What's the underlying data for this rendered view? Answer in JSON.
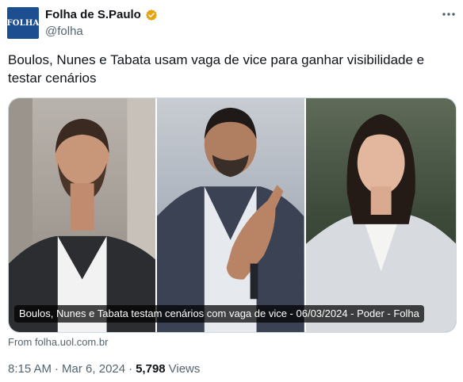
{
  "account": {
    "avatar_text": "FOLHA",
    "display_name": "Folha de S.Paulo",
    "handle": "@folha"
  },
  "tweet": {
    "text": "Boulos, Nunes e Tabata usam vaga de vice para ganhar visibilidade e testar cenários"
  },
  "card": {
    "caption": "Boulos, Nunes e Tabata testam cenários com vaga de vice - 06/03/2024 - Poder - Folha",
    "source": "From folha.uol.com.br"
  },
  "meta": {
    "time": "8:15 AM",
    "date": "Mar 6, 2024",
    "separator": "·",
    "views_count": "5,798",
    "views_label": "Views"
  },
  "colors": {
    "text": "#0f1419",
    "secondary": "#536471",
    "avatar_bg": "#1d4e8f",
    "verified_badge": "#e8a20c"
  }
}
